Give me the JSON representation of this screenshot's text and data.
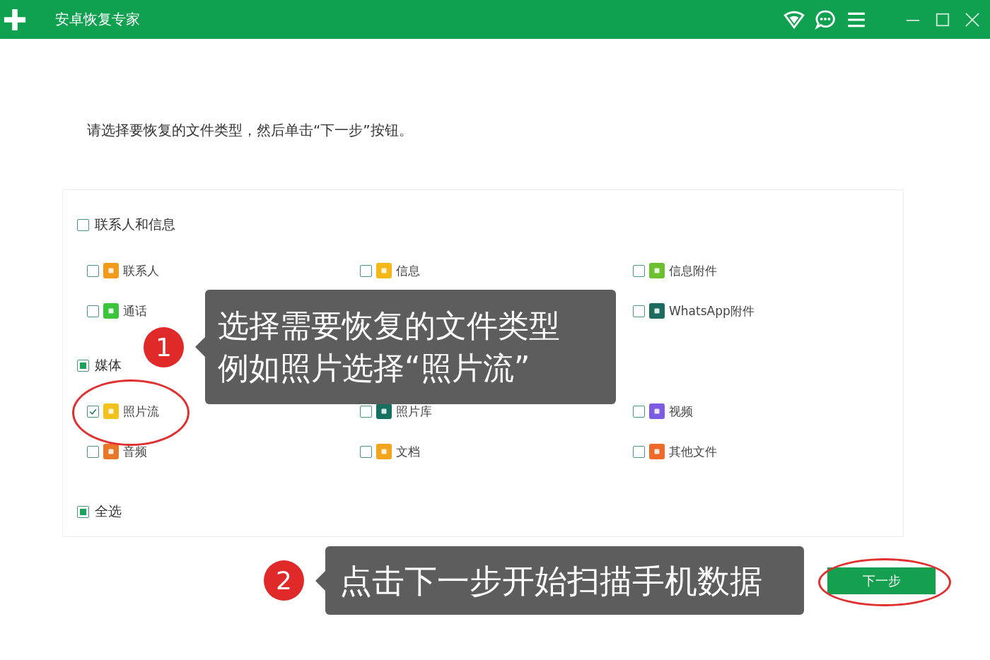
{
  "window": {
    "title": "安卓恢复专家"
  },
  "instruction": "请选择要恢复的文件类型，然后单击“下一步”按钮。",
  "groups": [
    {
      "label": "联系人和信息",
      "checked": false,
      "mixed": false,
      "columns": [
        [
          {
            "label": "联系人",
            "checked": false,
            "color": "#f29a1c"
          },
          {
            "label": "通话",
            "checked": false,
            "color": "#3cc43c"
          }
        ],
        [
          {
            "label": "信息",
            "checked": false,
            "color": "#f5b819"
          }
        ],
        [
          {
            "label": "信息附件",
            "checked": false,
            "color": "#6cbf2e"
          },
          {
            "label": "WhatsApp附件",
            "checked": false,
            "color": "#1d6b5e"
          }
        ]
      ]
    },
    {
      "label": "媒体",
      "checked": false,
      "mixed": true,
      "columns": [
        [
          {
            "label": "照片流",
            "checked": true,
            "color": "#f2c21c"
          },
          {
            "label": "音频",
            "checked": false,
            "color": "#e8772a"
          }
        ],
        [
          {
            "label": "照片库",
            "checked": false,
            "color": "#17705f"
          },
          {
            "label": "文档",
            "checked": false,
            "color": "#f2a51c"
          }
        ],
        [
          {
            "label": "视频",
            "checked": false,
            "color": "#7c5ce0"
          },
          {
            "label": "其他文件",
            "checked": false,
            "color": "#ee6a2a"
          }
        ]
      ]
    }
  ],
  "select_all": {
    "label": "全选",
    "checked": false,
    "mixed": true
  },
  "next_button": {
    "label": "下一步"
  },
  "annotations": [
    {
      "number": "1",
      "lines": [
        "选择需要恢复的文件类型",
        "例如照片选择“照片流”"
      ]
    },
    {
      "number": "2",
      "lines": [
        "点击下一步开始扫描手机数据"
      ]
    }
  ]
}
